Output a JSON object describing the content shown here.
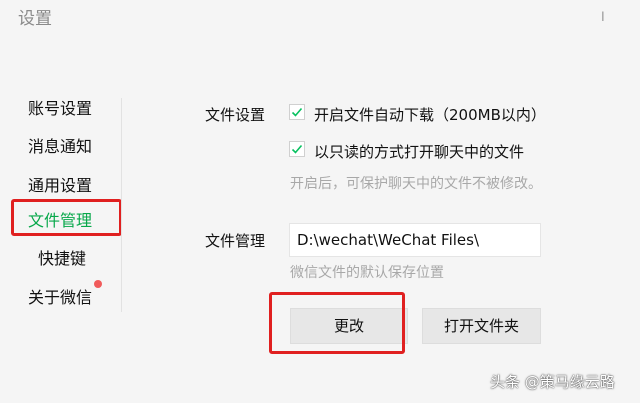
{
  "window": {
    "title": "设置",
    "close_glyph": "╷"
  },
  "sidebar": {
    "items": [
      {
        "label": "账号设置"
      },
      {
        "label": "消息通知"
      },
      {
        "label": "通用设置"
      },
      {
        "label": "文件管理"
      },
      {
        "label": "快捷键"
      },
      {
        "label": "关于微信"
      }
    ],
    "active_index": 3,
    "accent_color": "#07c160"
  },
  "file_settings": {
    "label": "文件设置",
    "options": [
      {
        "label": "开启文件自动下载（200MB以内）",
        "checked": true
      },
      {
        "label": "以只读的方式打开聊天中的文件",
        "checked": true
      }
    ],
    "hint": "开启后，可保护聊天中的文件不被修改。"
  },
  "file_management": {
    "label": "文件管理",
    "path": "D:\\wechat\\WeChat Files\\",
    "hint": "微信文件的默认保存位置",
    "change_button": "更改",
    "open_folder_button": "打开文件夹"
  },
  "annotation_color": "#e02020",
  "watermark": "头条 @策马缘云路"
}
